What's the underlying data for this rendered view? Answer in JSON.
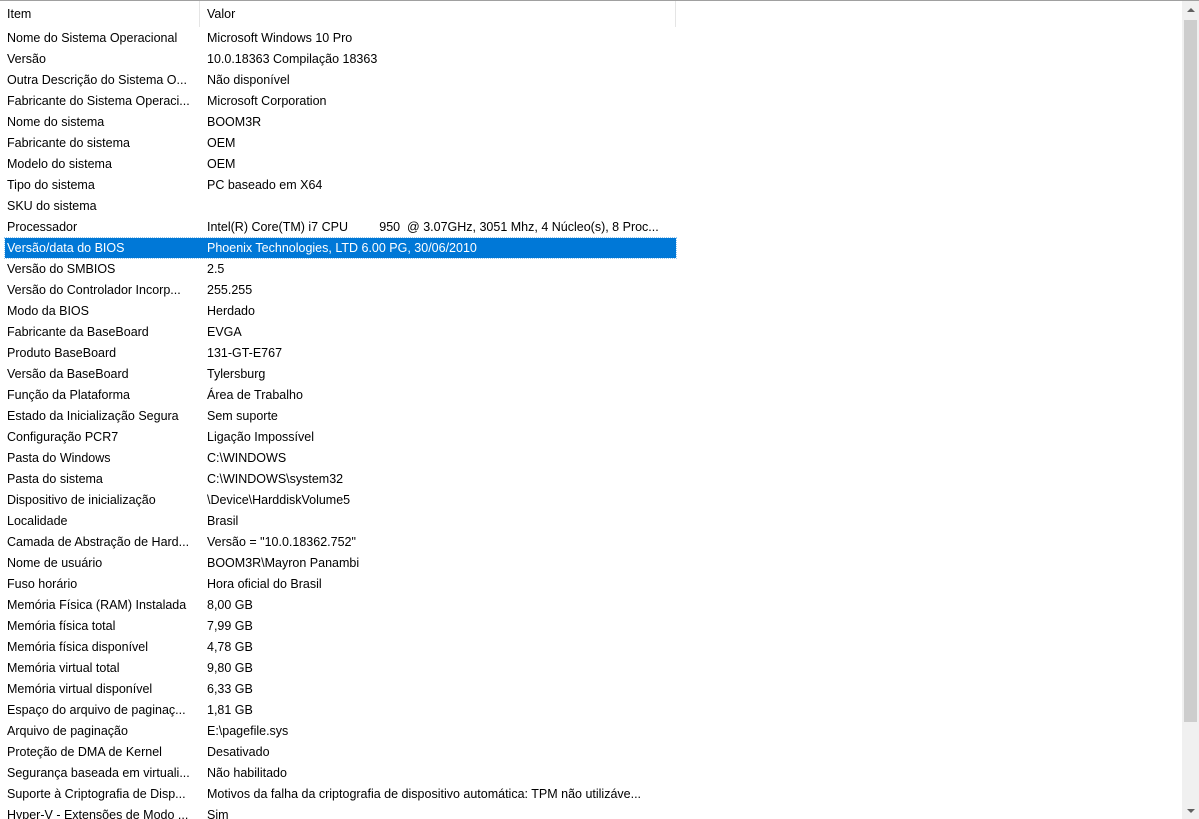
{
  "columns": {
    "item": "Item",
    "value": "Valor"
  },
  "colors": {
    "selection": "#0078d7",
    "selection_text": "#ffffff"
  },
  "selected_row_index": 10,
  "rows": [
    {
      "item": "Nome do Sistema Operacional",
      "value": "Microsoft Windows 10 Pro"
    },
    {
      "item": "Versão",
      "value": "10.0.18363 Compilação 18363"
    },
    {
      "item": "Outra Descrição do Sistema O...",
      "value": "Não disponível"
    },
    {
      "item": "Fabricante do Sistema Operaci...",
      "value": "Microsoft Corporation"
    },
    {
      "item": "Nome do sistema",
      "value": "BOOM3R"
    },
    {
      "item": "Fabricante do sistema",
      "value": "OEM"
    },
    {
      "item": "Modelo do sistema",
      "value": "OEM"
    },
    {
      "item": "Tipo do sistema",
      "value": "PC baseado em X64"
    },
    {
      "item": "SKU do sistema",
      "value": ""
    },
    {
      "item": "Processador",
      "value": "Intel(R) Core(TM) i7 CPU         950  @ 3.07GHz, 3051 Mhz, 4 Núcleo(s), 8 Proc..."
    },
    {
      "item": "Versão/data do BIOS",
      "value": "Phoenix Technologies, LTD 6.00 PG, 30/06/2010"
    },
    {
      "item": "Versão do SMBIOS",
      "value": "2.5"
    },
    {
      "item": "Versão do Controlador Incorp...",
      "value": "255.255"
    },
    {
      "item": "Modo da BIOS",
      "value": "Herdado"
    },
    {
      "item": "Fabricante da BaseBoard",
      "value": "EVGA"
    },
    {
      "item": "Produto BaseBoard",
      "value": "131-GT-E767"
    },
    {
      "item": "Versão da BaseBoard",
      "value": "Tylersburg"
    },
    {
      "item": "Função da Plataforma",
      "value": "Área de Trabalho"
    },
    {
      "item": "Estado da Inicialização Segura",
      "value": "Sem suporte"
    },
    {
      "item": "Configuração PCR7",
      "value": "Ligação Impossível"
    },
    {
      "item": "Pasta do Windows",
      "value": "C:\\WINDOWS"
    },
    {
      "item": "Pasta do sistema",
      "value": "C:\\WINDOWS\\system32"
    },
    {
      "item": "Dispositivo de inicialização",
      "value": "\\Device\\HarddiskVolume5"
    },
    {
      "item": "Localidade",
      "value": "Brasil"
    },
    {
      "item": "Camada de Abstração de Hard...",
      "value": "Versão = \"10.0.18362.752\""
    },
    {
      "item": "Nome de usuário",
      "value": "BOOM3R\\Mayron Panambi"
    },
    {
      "item": "Fuso horário",
      "value": "Hora oficial do Brasil"
    },
    {
      "item": "Memória Física (RAM) Instalada",
      "value": "8,00 GB"
    },
    {
      "item": "Memória física total",
      "value": "7,99 GB"
    },
    {
      "item": "Memória física disponível",
      "value": "4,78 GB"
    },
    {
      "item": "Memória virtual total",
      "value": "9,80 GB"
    },
    {
      "item": "Memória virtual disponível",
      "value": "6,33 GB"
    },
    {
      "item": "Espaço do arquivo de paginaç...",
      "value": "1,81 GB"
    },
    {
      "item": "Arquivo de paginação",
      "value": "E:\\pagefile.sys"
    },
    {
      "item": "Proteção de DMA de Kernel",
      "value": "Desativado"
    },
    {
      "item": "Segurança baseada em virtuali...",
      "value": "Não habilitado"
    },
    {
      "item": "Suporte à Criptografia de Disp...",
      "value": "Motivos da falha da criptografia de dispositivo automática: TPM não utilizáve..."
    },
    {
      "item": "Hyper-V - Extensões de Modo ...",
      "value": "Sim"
    }
  ],
  "scrollbar": {
    "up_icon": "chevron-up-icon",
    "down_icon": "chevron-down-icon"
  }
}
